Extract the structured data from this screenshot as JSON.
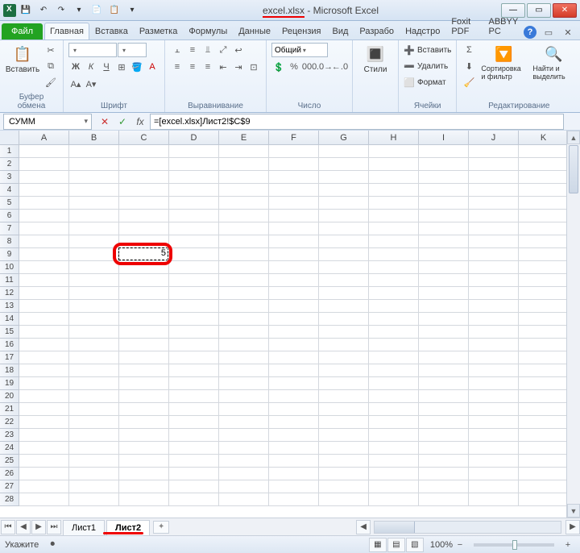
{
  "titlebar": {
    "filename": "excel.xlsx",
    "app": "Microsoft Excel"
  },
  "ribbon_tabs": {
    "file": "Файл",
    "items": [
      "Главная",
      "Вставка",
      "Разметка",
      "Формулы",
      "Данные",
      "Рецензия",
      "Вид",
      "Разрабо",
      "Надстро",
      "Foxit PDF",
      "ABBYY PC"
    ]
  },
  "ribbon": {
    "clipboard": {
      "paste": "Вставить",
      "label": "Буфер обмена"
    },
    "font": {
      "label": "Шрифт"
    },
    "alignment": {
      "label": "Выравнивание"
    },
    "number": {
      "format": "Общий",
      "label": "Число"
    },
    "styles": {
      "btn": "Стили",
      "label": ""
    },
    "cells": {
      "insert": "Вставить",
      "delete": "Удалить",
      "format": "Формат",
      "label": "Ячейки"
    },
    "editing": {
      "sort": "Сортировка и фильтр",
      "find": "Найти и выделить",
      "label": "Редактирование"
    }
  },
  "formula_bar": {
    "name_box": "СУММ",
    "formula": "=[excel.xlsx]Лист2!$C$9"
  },
  "grid": {
    "columns": [
      "A",
      "B",
      "C",
      "D",
      "E",
      "F",
      "G",
      "H",
      "I",
      "J",
      "K"
    ],
    "rows": 28,
    "selected_cell": "C9",
    "selected_value": "5"
  },
  "sheets": {
    "tabs": [
      "Лист1",
      "Лист2"
    ],
    "active": 1
  },
  "statusbar": {
    "mode": "Укажите",
    "zoom": "100%"
  },
  "colors": {
    "accent": "#3a7ad9",
    "highlight": "#e00",
    "excel_green": "#22a321"
  }
}
